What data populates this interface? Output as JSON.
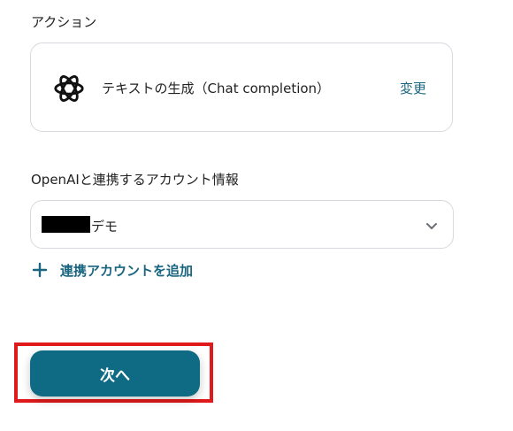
{
  "action_section": {
    "label": "アクション",
    "action_name": "テキストの生成（Chat completion）",
    "change_label": "変更",
    "icon": "openai-logo-icon"
  },
  "account_section": {
    "label": "OpenAIと連携するアカウント情報",
    "selected_account": "デモ",
    "dropdown_icon": "chevron-down-icon",
    "add_account_label": "連携アカウントを追加",
    "add_icon": "plus-icon"
  },
  "footer": {
    "next_label": "次へ"
  },
  "colors": {
    "accent": "#1a6580",
    "button_bg": "#0f6a84",
    "highlight": "#e0191a",
    "border": "#d6dade"
  }
}
